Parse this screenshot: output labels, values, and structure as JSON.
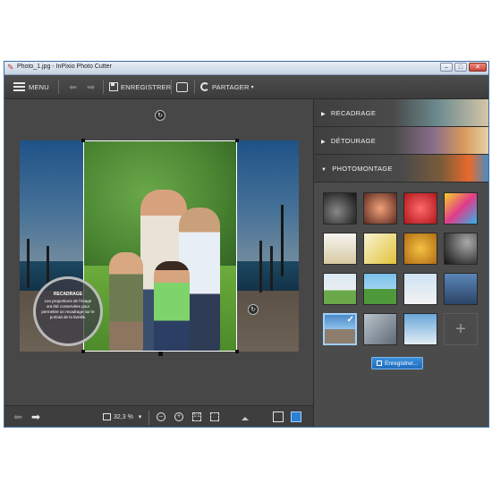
{
  "window": {
    "title": "Photo_1.jpg - InPixio Photo Cutter"
  },
  "toolbar": {
    "menu_label": "MENU",
    "save_label": "ENREGISTRER",
    "share_label": "PARTAGER"
  },
  "canvas": {
    "tooltip_title": "RECADRAGE",
    "tooltip_text": "Les proportions de l'image ont été conservées pour permettre un recadrage sur le portrait de la famille."
  },
  "bottom": {
    "zoom_value": "32,3 %",
    "zoom_caret": "▾"
  },
  "panel": {
    "sections": [
      {
        "label": "RECADRAGE"
      },
      {
        "label": "DÉTOURAGE"
      },
      {
        "label": "PHOTOMONTAGE"
      }
    ],
    "save_button": "Enregistrer..."
  },
  "colors": {
    "accent": "#1f6cbf",
    "panel_bg": "#4b4b4b",
    "canvas_bg": "#474747"
  },
  "icons": [
    "menu-icon",
    "undo-icon",
    "redo-icon",
    "save-icon",
    "print-icon",
    "share-icon",
    "zoom-out-icon",
    "zoom-in-icon",
    "fit-icon",
    "full-icon",
    "prev-icon",
    "next-icon"
  ]
}
